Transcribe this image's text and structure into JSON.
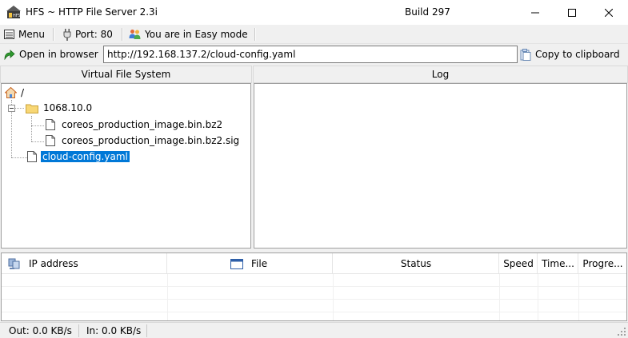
{
  "window": {
    "title": "HFS ~ HTTP File Server 2.3i",
    "build": "Build 297",
    "minimize_icon": "minimize-icon",
    "maximize_icon": "maximize-icon",
    "close_icon": "close-icon"
  },
  "toolbar": {
    "menu_label": "Menu",
    "port_label": "Port: 80",
    "mode_label": "You are in Easy mode"
  },
  "urlbar": {
    "open_label": "Open in browser",
    "url_value": "http://192.168.137.2/cloud-config.yaml",
    "copy_label": "Copy to clipboard"
  },
  "vfs": {
    "header": "Virtual File System",
    "root": "/",
    "folder": "1068.10.0",
    "folder_files": [
      "coreos_production_image.bin.bz2",
      "coreos_production_image.bin.bz2.sig"
    ],
    "selected_file": "cloud-config.yaml"
  },
  "log": {
    "header": "Log"
  },
  "connections": {
    "columns": [
      "IP address",
      "File",
      "Status",
      "Speed",
      "Time...",
      "Progre..."
    ]
  },
  "statusbar": {
    "out": "Out: 0.0 KB/s",
    "in": "In: 0.0 KB/s"
  },
  "colors": {
    "selection": "#0078d7",
    "background": "#f0f0f0"
  }
}
